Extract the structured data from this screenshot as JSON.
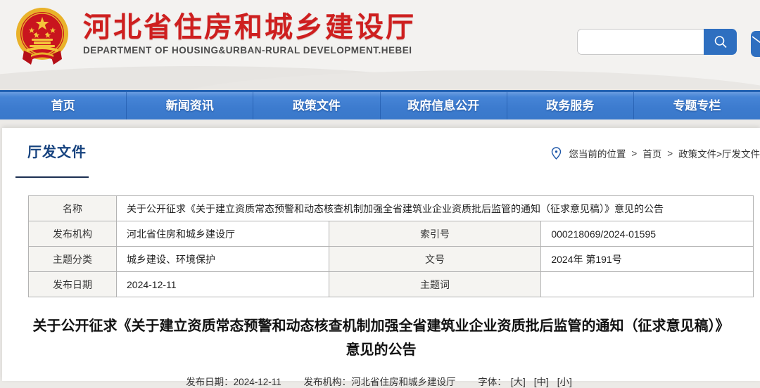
{
  "header": {
    "site_title": "河北省住房和城乡建设厅",
    "site_subtitle": "DEPARTMENT OF HOUSING&URBAN-RURAL DEVELOPMENT.HEBEI",
    "search": {
      "placeholder": ""
    }
  },
  "nav": {
    "items": [
      {
        "label": "首页"
      },
      {
        "label": "新闻资讯"
      },
      {
        "label": "政策文件"
      },
      {
        "label": "政府信息公开"
      },
      {
        "label": "政务服务"
      },
      {
        "label": "专题专栏"
      }
    ]
  },
  "section": {
    "title": "厅发文件",
    "breadcrumb": {
      "prefix": "您当前的位置",
      "sep": ">",
      "home": "首页",
      "current": "政策文件>厅发文件"
    }
  },
  "doc_table": {
    "name_label": "名称",
    "name_value": "关于公开征求《关于建立资质常态预警和动态核查机制加强全省建筑业企业资质批后监管的通知（征求意见稿）》意见的公告",
    "rows": [
      {
        "l1": "发布机构",
        "v1": "河北省住房和城乡建设厅",
        "l2": "索引号",
        "v2": "000218069/2024-01595"
      },
      {
        "l1": "主题分类",
        "v1": "城乡建设、环境保护",
        "l2": "文号",
        "v2": "2024年 第191号"
      },
      {
        "l1": "发布日期",
        "v1": "2024-12-11",
        "l2": "主题词",
        "v2": ""
      }
    ]
  },
  "article": {
    "title": "关于公开征求《关于建立资质常态预警和动态核查机制加强全省建筑业企业资质批后监管的通知（征求意见稿）》意见的公告",
    "meta": {
      "date_label": "发布日期：",
      "date": "2024-12-11",
      "org_label": "发布机构：",
      "org": "河北省住房和城乡建设厅",
      "font_label": "字体：",
      "font_sizes": [
        "[大]",
        "[中]",
        "[小]"
      ]
    }
  },
  "colors": {
    "brand_red": "#ce1f1f",
    "nav_blue": "#3c7bce",
    "accent_navy": "#17437f",
    "search_button_blue": "#2e6fc0"
  }
}
